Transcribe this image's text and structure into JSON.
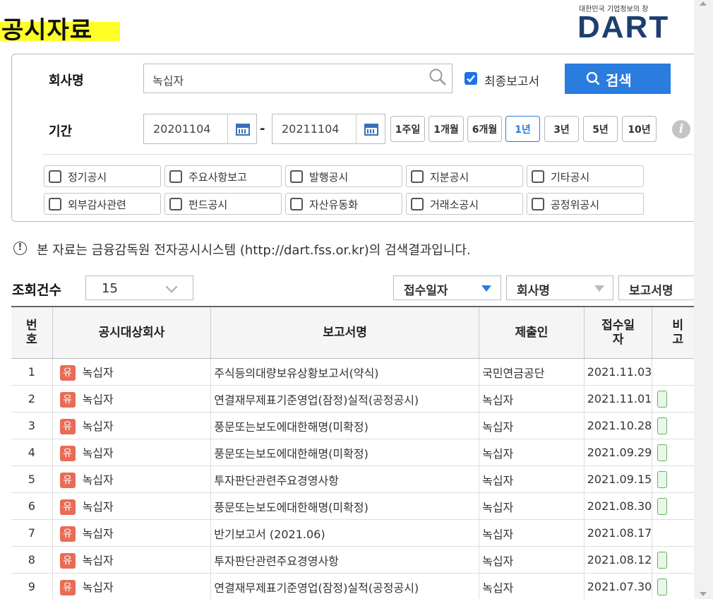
{
  "header": {
    "title": "공시자료",
    "logo_sub": "대한민국 기업정보의 창",
    "logo": "DART"
  },
  "search": {
    "company_label": "회사명",
    "company_value": "녹십자",
    "latest_report_label": "최종보고서",
    "latest_report_checked": true,
    "search_button": "검색",
    "period_label": "기간",
    "date_from": "20201104",
    "date_to": "20211104",
    "date_separator": "-",
    "period_buttons": [
      "1주일",
      "1개월",
      "6개월",
      "1년",
      "3년",
      "5년",
      "10년"
    ],
    "period_active": "1년",
    "categories": [
      "정기공시",
      "주요사항보고",
      "발행공시",
      "지분공시",
      "기타공시",
      "외부감사관련",
      "펀드공시",
      "자산유동화",
      "거래소공시",
      "공정위공시"
    ]
  },
  "notice": "본 자료는 금융감독원 전자공시시스템 (http://dart.fss.or.kr)의 검색결과입니다.",
  "list_controls": {
    "count_label": "조회건수",
    "count_value": "15",
    "sort_options": [
      "접수일자",
      "회사명",
      "보고서명"
    ],
    "sort_active": "접수일자"
  },
  "table": {
    "headers": [
      "번호",
      "공시대상회사",
      "보고서명",
      "제출인",
      "접수일자",
      "비고"
    ],
    "rows": [
      {
        "no": "1",
        "badge": "유",
        "company": "녹십자",
        "report": "주식등의대량보유상황보고서(약식)",
        "submitter": "국민연금공단",
        "date": "2021.11.03",
        "remark": false
      },
      {
        "no": "2",
        "badge": "유",
        "company": "녹십자",
        "report": "연결재무제표기준영업(잠정)실적(공정공시)",
        "submitter": "녹십자",
        "date": "2021.11.01",
        "remark": true
      },
      {
        "no": "3",
        "badge": "유",
        "company": "녹십자",
        "report": "풍문또는보도에대한해명(미확정)",
        "submitter": "녹십자",
        "date": "2021.10.28",
        "remark": true
      },
      {
        "no": "4",
        "badge": "유",
        "company": "녹십자",
        "report": "풍문또는보도에대한해명(미확정)",
        "submitter": "녹십자",
        "date": "2021.09.29",
        "remark": true
      },
      {
        "no": "5",
        "badge": "유",
        "company": "녹십자",
        "report": "투자판단관련주요경영사항",
        "submitter": "녹십자",
        "date": "2021.09.15",
        "remark": true
      },
      {
        "no": "6",
        "badge": "유",
        "company": "녹십자",
        "report": "풍문또는보도에대한해명(미확정)",
        "submitter": "녹십자",
        "date": "2021.08.30",
        "remark": true
      },
      {
        "no": "7",
        "badge": "유",
        "company": "녹십자",
        "report": "반기보고서 (2021.06)",
        "submitter": "녹십자",
        "date": "2021.08.17",
        "remark": false
      },
      {
        "no": "8",
        "badge": "유",
        "company": "녹십자",
        "report": "투자판단관련주요경영사항",
        "submitter": "녹십자",
        "date": "2021.08.12",
        "remark": true
      },
      {
        "no": "9",
        "badge": "유",
        "company": "녹십자",
        "report": "연결재무제표기준영업(잠정)실적(공정공시)",
        "submitter": "녹십자",
        "date": "2021.07.30",
        "remark": true
      }
    ]
  },
  "colors": {
    "title_highlight": "#ffff28",
    "accent": "#2a7cdf",
    "badge": "#e86c55",
    "remark_badge": "#5cb85c",
    "logo": "#1c3f6e"
  }
}
